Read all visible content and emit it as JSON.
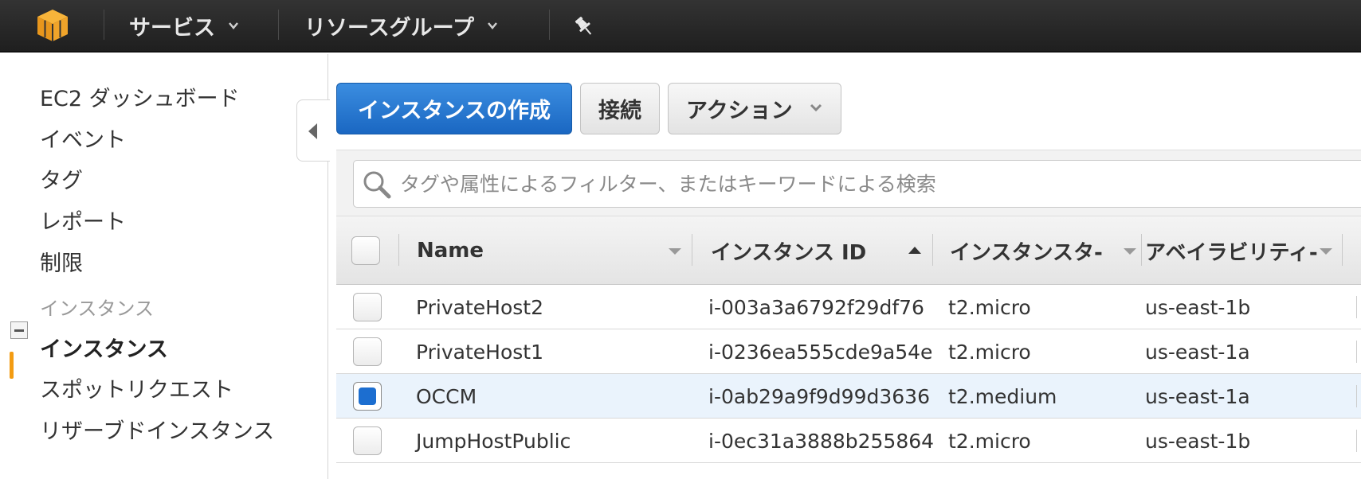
{
  "colors": {
    "nav_bg": "#2b2b2b",
    "primary_button": "#1a6fd0",
    "active_accent": "#f39c12",
    "selected_row": "#eaf3fc"
  },
  "icons": {
    "logo": "aws-cube-icon",
    "chevron": "chevron-down-icon",
    "pin": "pin-icon",
    "search": "search-icon",
    "collapse": "minus-box-icon",
    "toggle": "caret-left-icon"
  },
  "topnav": {
    "services": "サービス",
    "resource_groups": "リソースグループ"
  },
  "sidebar": {
    "items": [
      {
        "label": "EC2 ダッシュボード"
      },
      {
        "label": "イベント"
      },
      {
        "label": "タグ"
      },
      {
        "label": "レポート"
      },
      {
        "label": "制限"
      }
    ],
    "section": "インスタンス",
    "section_items": [
      {
        "label": "インスタンス",
        "active": true
      },
      {
        "label": "スポットリクエスト",
        "active": false
      },
      {
        "label": "リザーブドインスタンス",
        "active": false
      }
    ]
  },
  "toolbar": {
    "create_label": "インスタンスの作成",
    "connect_label": "接続",
    "actions_label": "アクション"
  },
  "search": {
    "placeholder": "タグや属性によるフィルター、またはキーワードによる検索",
    "value": ""
  },
  "table": {
    "columns": [
      "Name",
      "インスタンス ID",
      "インスタンスタ-",
      "アベイラビリティ-"
    ],
    "sorted_column": "インスタンス ID",
    "sort_direction": "ascending",
    "rows": [
      {
        "name": "PrivateHost2",
        "id": "i-003a3a6792f29df76",
        "type": "t2.micro",
        "az": "us-east-1b",
        "selected": false
      },
      {
        "name": "PrivateHost1",
        "id": "i-0236ea555cde9a54e",
        "type": "t2.micro",
        "az": "us-east-1a",
        "selected": false
      },
      {
        "name": "OCCM",
        "id": "i-0ab29a9f9d99d3636",
        "type": "t2.medium",
        "az": "us-east-1a",
        "selected": true
      },
      {
        "name": "JumpHostPublic",
        "id": "i-0ec31a3888b255864",
        "type": "t2.micro",
        "az": "us-east-1b",
        "selected": false
      }
    ]
  }
}
